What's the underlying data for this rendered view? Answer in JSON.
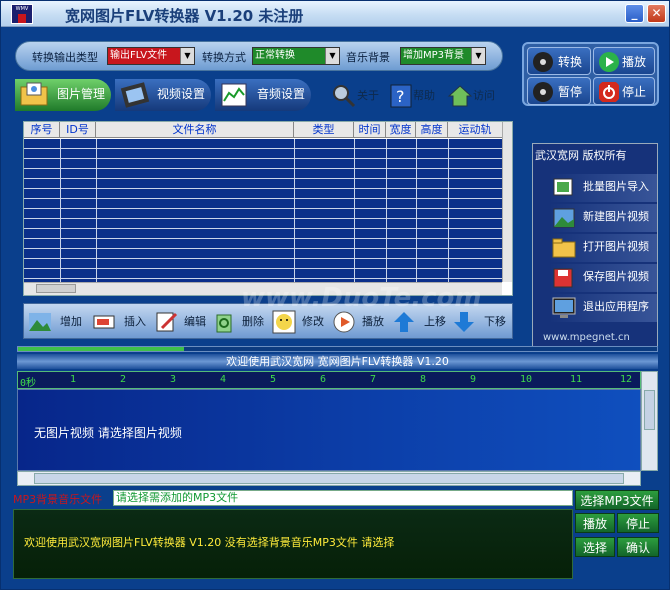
{
  "window": {
    "title": "宽网图片FLV转换器  V1.20 未注册",
    "min_glyph": "_",
    "close_glyph": "✕",
    "icon_text": "WMV"
  },
  "toolbar": {
    "output_type_label": "转换输出类型",
    "output_type_value": "输出FLV文件",
    "mode_label": "转换方式",
    "mode_value": "正常转换",
    "music_label": "音乐背景",
    "music_value": "增加MP3背景"
  },
  "tabs": [
    {
      "label": "图片管理"
    },
    {
      "label": "视频设置"
    },
    {
      "label": "音频设置"
    }
  ],
  "links": {
    "about": "关于",
    "help": "帮助",
    "visit": "访问"
  },
  "right_buttons": {
    "convert": "转换",
    "play": "播放",
    "pause": "暂停",
    "stop": "停止"
  },
  "grid": {
    "headers": [
      "序号",
      "ID号",
      "文件名称",
      "类型",
      "时间",
      "宽度",
      "高度",
      "运动轨"
    ]
  },
  "actions": [
    "增加",
    "插入",
    "编辑",
    "删除",
    "修改",
    "播放",
    "上移",
    "下移"
  ],
  "side_panel": {
    "title": "武汉宽网  版权所有",
    "items": [
      "批量图片导入",
      "新建图片视频",
      "打开图片视频",
      "保存图片视频",
      "退出应用程序"
    ],
    "footer": "www.mpegnet.cn"
  },
  "progress": {
    "fraction": 0.26
  },
  "welcome": "欢迎使用武汉宽网 宽网图片FLV转换器 V1.20",
  "ruler": [
    "0秒",
    "1",
    "2",
    "3",
    "4",
    "5",
    "6",
    "7",
    "8",
    "9",
    "10",
    "11",
    "12"
  ],
  "timeline_message": "无图片视频  请选择图片视频",
  "mp3": {
    "label": "MP3背景音乐文件",
    "placeholder": "请选择需添加的MP3文件"
  },
  "console": {
    "message": "欢迎使用武汉宽网图片FLV转换器 V1.20 没有选择背景音乐MP3文件 请选择"
  },
  "mp3_buttons": {
    "select": "选择MP3文件",
    "play": "播放",
    "stop": "停止",
    "choose": "选择",
    "confirm": "确认"
  },
  "watermark": "www.DuoTe.com",
  "colors": {
    "accent": "#0a3f8c",
    "output_type": "#c8161d",
    "mode": "#1f8a2a",
    "music": "#1f8a2a",
    "console_text": "#ffeb3b"
  }
}
